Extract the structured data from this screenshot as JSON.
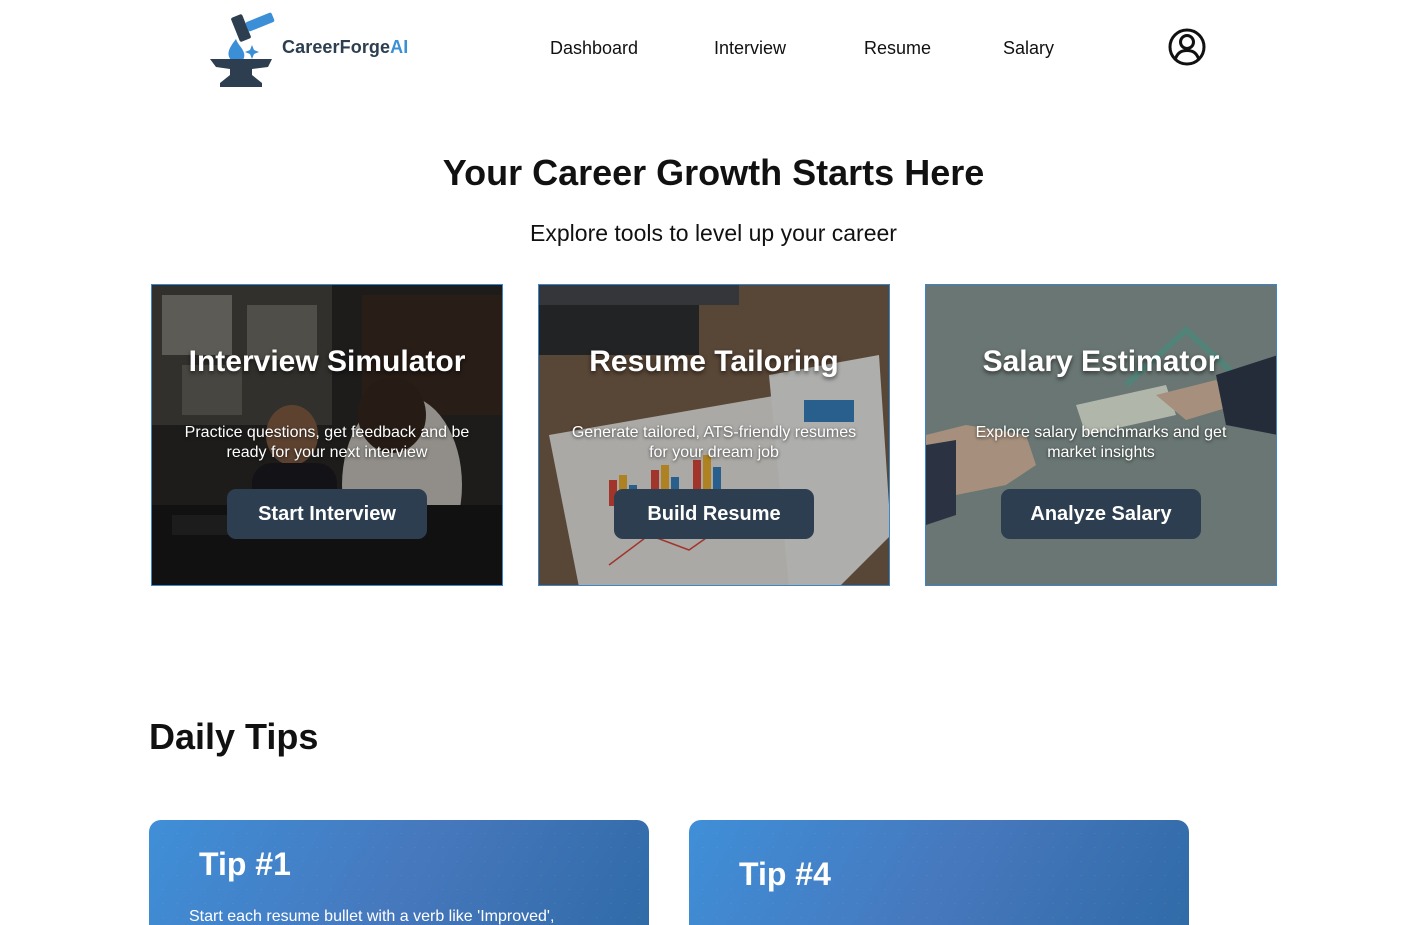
{
  "brand": {
    "name_main": "CareerForge",
    "name_accent": "AI"
  },
  "nav": {
    "items": [
      "Dashboard",
      "Interview",
      "Resume",
      "Salary"
    ]
  },
  "hero": {
    "title": "Your Career Growth Starts Here",
    "subtitle": "Explore tools to level up your career"
  },
  "tools": [
    {
      "title": "Interview Simulator",
      "description": "Practice questions, get feedback and be ready for your next interview",
      "button": "Start Interview"
    },
    {
      "title": "Resume Tailoring",
      "description": "Generate tailored, ATS-friendly resumes for your dream job",
      "button": "Build Resume"
    },
    {
      "title": "Salary Estimator",
      "description": "Explore salary benchmarks and get market insights",
      "button": "Analyze Salary"
    }
  ],
  "tips": {
    "heading": "Daily Tips",
    "cards": [
      {
        "label": "Tip #1",
        "text": "Start each resume bullet with a verb like 'Improved',"
      },
      {
        "label": "Tip #4",
        "text": ""
      }
    ]
  },
  "colors": {
    "accent": "#3b8fd6",
    "button": "#2c3e50",
    "card_border": "#3a86c8"
  },
  "icons": {
    "profile": "user-circle-icon",
    "logo": "anvil-hammer-logo"
  }
}
